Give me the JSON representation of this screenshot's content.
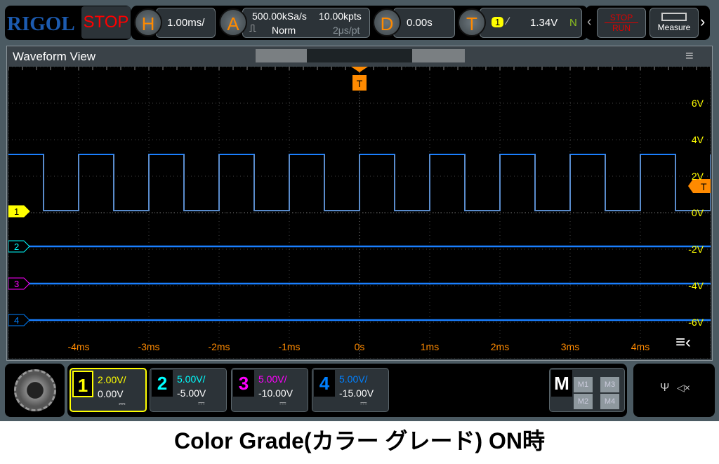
{
  "top": {
    "brand": "RIGOL",
    "run_state": "STOP",
    "horizontal": {
      "key": "H",
      "scale": "1.00ms/"
    },
    "acquire": {
      "key": "A",
      "sample_rate": "500.00kSa/s",
      "memory": "10.00kpts",
      "mode": "Norm",
      "time_per_pt": "2μs/pt"
    },
    "delay": {
      "key": "D",
      "value": "0.00s"
    },
    "trigger": {
      "key": "T",
      "source": "1",
      "level": "1.34V",
      "mode": "N"
    },
    "stop_run": {
      "stop": "STOP",
      "run": "RUN"
    },
    "measure": "Measure"
  },
  "waveform_view": {
    "title": "Waveform View",
    "trigger_marker": "T",
    "x_ticks": [
      "-4ms",
      "-3ms",
      "-2ms",
      "-1ms",
      "0s",
      "1ms",
      "2ms",
      "3ms",
      "4ms"
    ],
    "y_ticks": [
      "6V",
      "4V",
      "2V",
      "0V",
      "-2V",
      "-4V",
      "-6V"
    ],
    "channel_markers": [
      "1",
      "2",
      "3",
      "4"
    ]
  },
  "channels": [
    {
      "num": "1",
      "scale": "2.00V/",
      "offset": "0.00V",
      "color": "#ffff00"
    },
    {
      "num": "2",
      "scale": "5.00V/",
      "offset": "-5.00V",
      "color": "#00ffff"
    },
    {
      "num": "3",
      "scale": "5.00V/",
      "offset": "-10.00V",
      "color": "#ff00ff"
    },
    {
      "num": "4",
      "scale": "5.00V/",
      "offset": "-15.00V",
      "color": "#0080ff"
    }
  ],
  "math": {
    "key": "M",
    "buttons": [
      "M1",
      "M3",
      "M2",
      "M4"
    ]
  },
  "status": {
    "usb": "usb-icon",
    "sound": "mute-icon"
  },
  "caption": "Color Grade(カラー グレード) ON時",
  "colors": {
    "trace": "#1a7fff",
    "accent": "#ff8a00"
  }
}
